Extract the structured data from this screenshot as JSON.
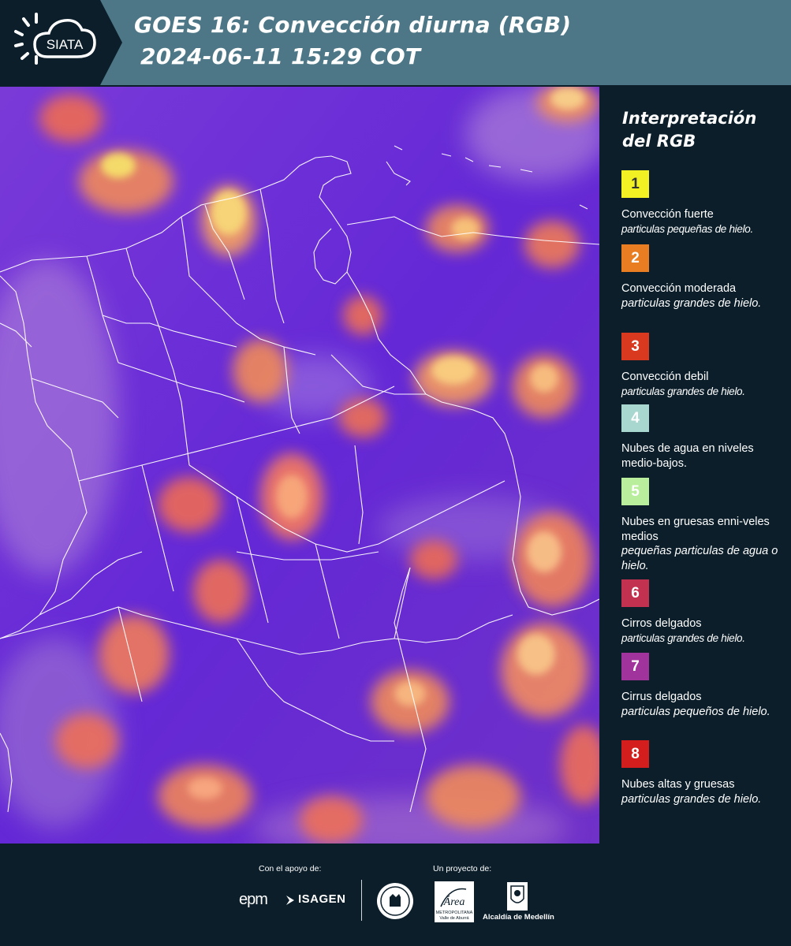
{
  "header": {
    "logo_text": "SIATA",
    "title_line1": "GOES 16: Convección diurna (RGB)",
    "title_line2": "2024-06-11 15:29 COT"
  },
  "legend": {
    "title": "Interpretación del RGB",
    "items": [
      {
        "num": "1",
        "color": "#f1f123",
        "numColor": "#333333",
        "label": "Convección fuerte",
        "detail": "particulas pequeñas de hielo."
      },
      {
        "num": "2",
        "color": "#e87d22",
        "numColor": "#ffffff",
        "label": "Convección moderada",
        "detail": "particulas grandes de hielo."
      },
      {
        "num": "3",
        "color": "#d93a1f",
        "numColor": "#ffffff",
        "label": "Convección debil",
        "detail": "particulas grandes de hielo."
      },
      {
        "num": "4",
        "color": "#a8d7cf",
        "numColor": "#ffffff",
        "label": "Nubes de agua en niveles medio-bajos.",
        "detail": ""
      },
      {
        "num": "5",
        "color": "#b9ee9c",
        "numColor": "#ffffff",
        "label": "Nubes en gruesas enni-veles medios",
        "detail": "pequeñas particulas de agua o hielo."
      },
      {
        "num": "6",
        "color": "#c23150",
        "numColor": "#ffffff",
        "label": "Cirros delgados",
        "detail": "particulas grandes de hielo."
      },
      {
        "num": "7",
        "color": "#a0339c",
        "numColor": "#ffffff",
        "label": "Cirrus delgados",
        "detail": "particulas pequeños de hielo."
      },
      {
        "num": "8",
        "color": "#d41e1e",
        "numColor": "#ffffff",
        "label": "Nubes altas y gruesas",
        "detail": "particulas grandes de hielo."
      }
    ]
  },
  "footer": {
    "support_label": "Con el apoyo de:",
    "project_label": "Un proyecto de:",
    "epm": "epm",
    "isagen": "ISAGEN",
    "area_logo": "Área",
    "area_sub1": "METROPOLITANA",
    "area_sub2": "Valle de Aburrá",
    "alcaldia": "Alcaldía de Medellín"
  },
  "colors": {
    "header_bg": "#4d7786",
    "panel_bg": "#0b1e2a",
    "map_base": "#6a2fd2"
  }
}
